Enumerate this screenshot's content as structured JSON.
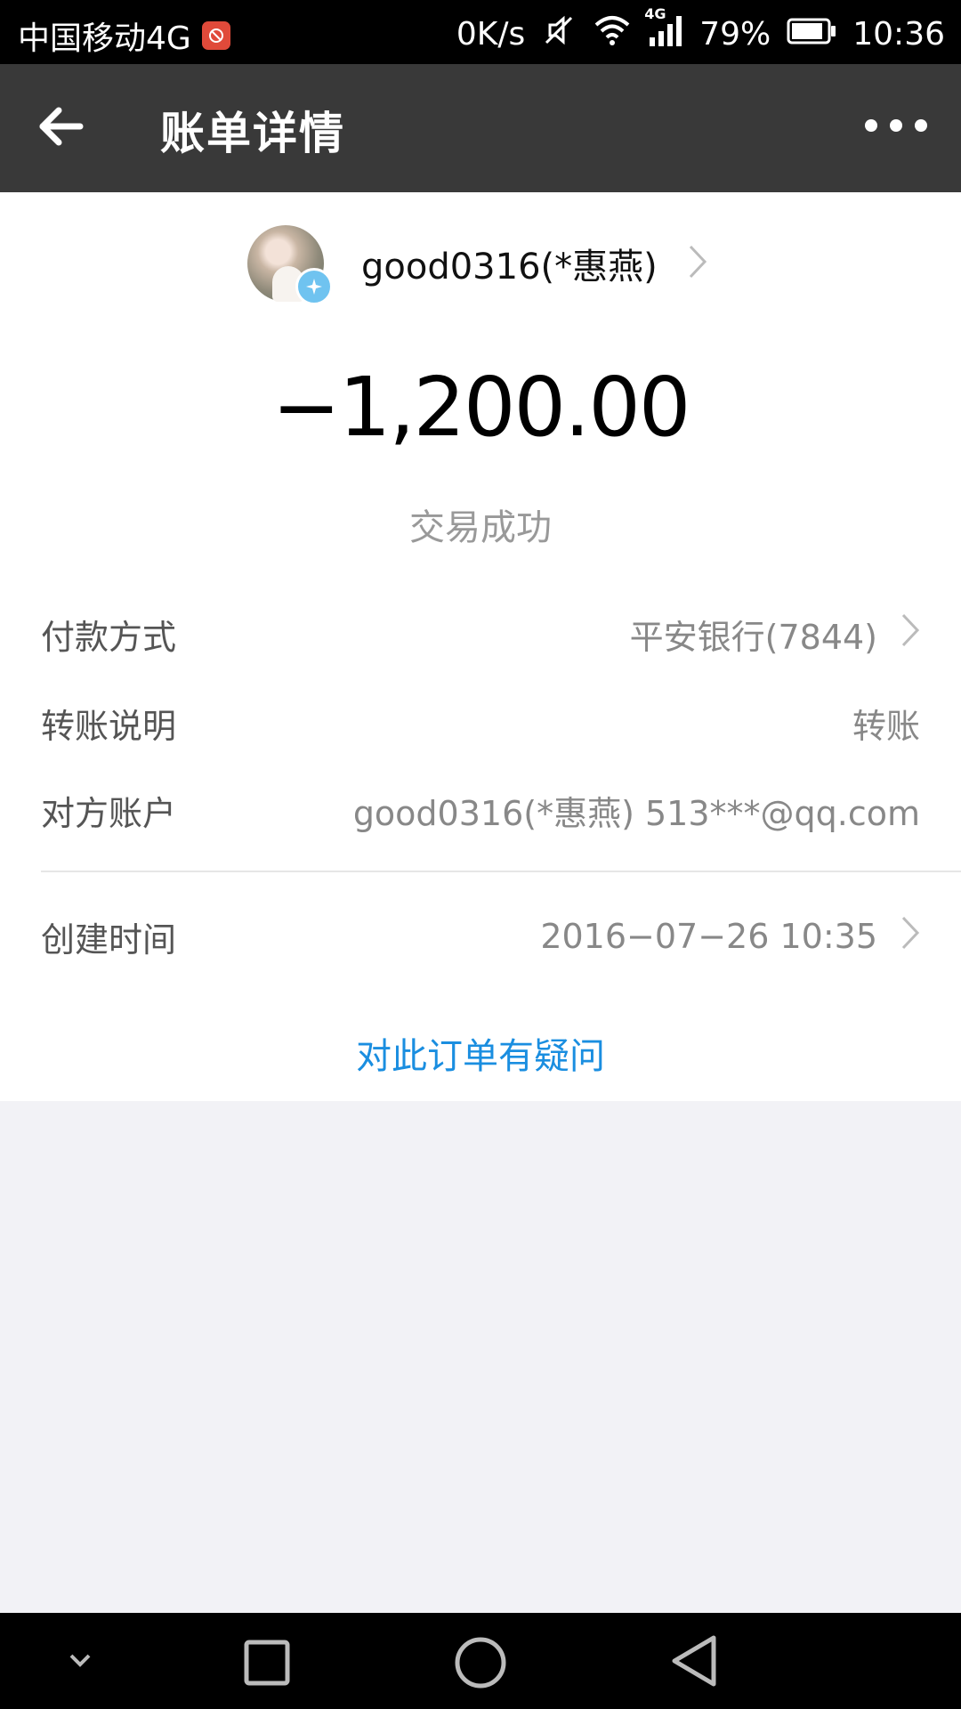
{
  "status_bar": {
    "carrier": "中国移动4G",
    "speed": "0K/s",
    "network": "4G",
    "battery": "79%",
    "time": "10:36"
  },
  "app_bar": {
    "title": "账单详情"
  },
  "payee": {
    "name": "good0316(*惠燕)"
  },
  "amount": "−1,200.00",
  "status": "交易成功",
  "details": [
    {
      "label": "付款方式",
      "value": "平安银行(7844)"
    },
    {
      "label": "转账说明",
      "value": "转账"
    },
    {
      "label": "对方账户",
      "value": "good0316(*惠燕) 513***@qq.com"
    },
    {
      "label": "创建时间",
      "value": "2016−07−26 10:35"
    }
  ],
  "question_link": "对此订单有疑问",
  "colors": {
    "app_bar": "#393939",
    "link": "#1a8ee0",
    "page_background": "#f2f2f6"
  }
}
